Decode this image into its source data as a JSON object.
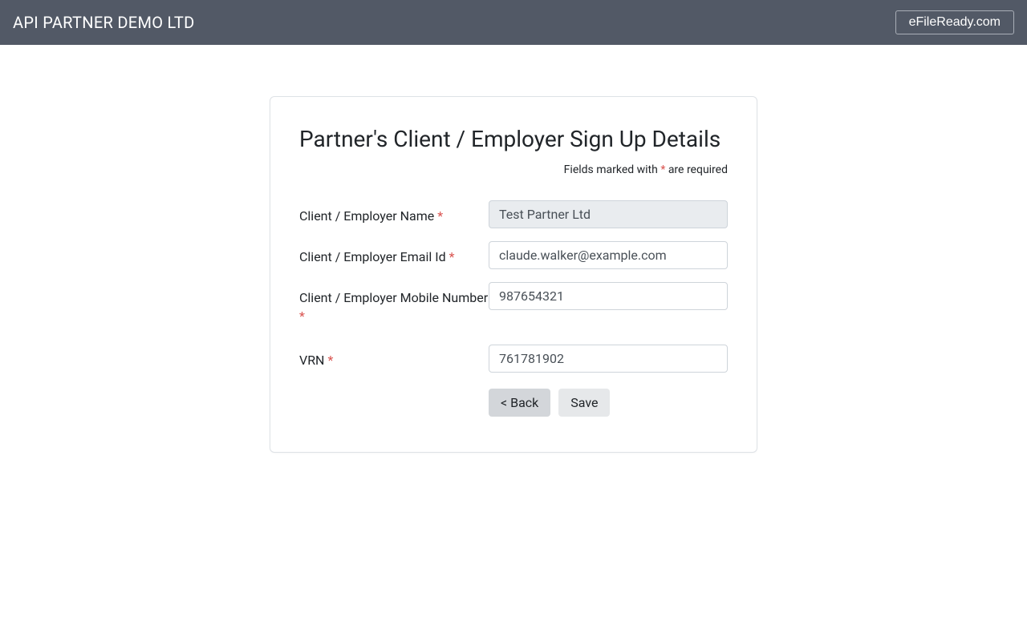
{
  "header": {
    "title": "API PARTNER DEMO LTD",
    "link_label": "eFileReady.com"
  },
  "card": {
    "title": "Partner's Client / Employer Sign Up Details",
    "required_note_prefix": "Fields marked with ",
    "required_note_suffix": " are required"
  },
  "form": {
    "name": {
      "label": "Client / Employer Name ",
      "value": "Test Partner Ltd"
    },
    "email": {
      "label": "Client / Employer Email Id ",
      "value": "claude.walker@example.com"
    },
    "mobile": {
      "label": "Client / Employer Mobile Number ",
      "value": "987654321"
    },
    "vrn": {
      "label": "VRN ",
      "value": "761781902"
    }
  },
  "buttons": {
    "back": "< Back",
    "save": "Save"
  },
  "required_marker": "*"
}
